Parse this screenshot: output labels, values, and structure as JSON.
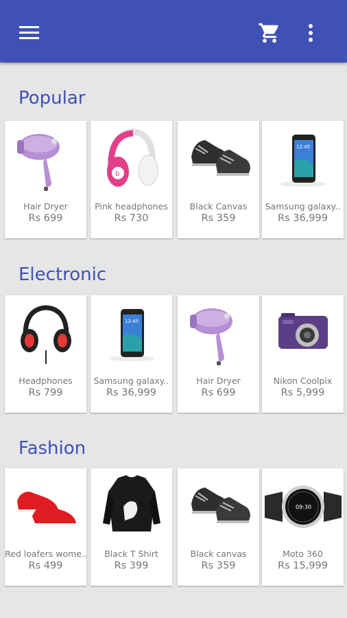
{
  "appbar": {
    "color": "#3f51b5",
    "menu_icon": "menu-icon",
    "cart_icon": "cart-icon",
    "more_icon": "more-vert-icon"
  },
  "sections": [
    {
      "title": "Popular",
      "items": [
        {
          "name": "Hair Dryer",
          "price": "Rs 699",
          "icon": "hair-dryer"
        },
        {
          "name": "Pink headphones",
          "price": "Rs 730",
          "icon": "pink-headphones"
        },
        {
          "name": "Black Canvas",
          "price": "Rs 359",
          "icon": "black-shoes"
        },
        {
          "name": "Samsung galaxy..",
          "price": "Rs 36,999",
          "icon": "smartphone"
        }
      ]
    },
    {
      "title": "Electronic",
      "items": [
        {
          "name": "Headphones",
          "price": "Rs 799",
          "icon": "black-headphones"
        },
        {
          "name": "Samsung galaxy..",
          "price": "Rs 36,999",
          "icon": "smartphone"
        },
        {
          "name": "Hair Dryer",
          "price": "Rs 699",
          "icon": "hair-dryer"
        },
        {
          "name": "Nikon Coolpix",
          "price": "Rs 5,999",
          "icon": "camera"
        }
      ]
    },
    {
      "title": "Fashion",
      "items": [
        {
          "name": "Red loafers wome..",
          "price": "Rs 499",
          "icon": "red-loafers"
        },
        {
          "name": "Black T Shirt",
          "price": "Rs 399",
          "icon": "tshirt"
        },
        {
          "name": "Black canvas",
          "price": "Rs 359",
          "icon": "black-shoes"
        },
        {
          "name": "Moto 360",
          "price": "Rs 15,999",
          "icon": "smartwatch"
        }
      ]
    }
  ]
}
